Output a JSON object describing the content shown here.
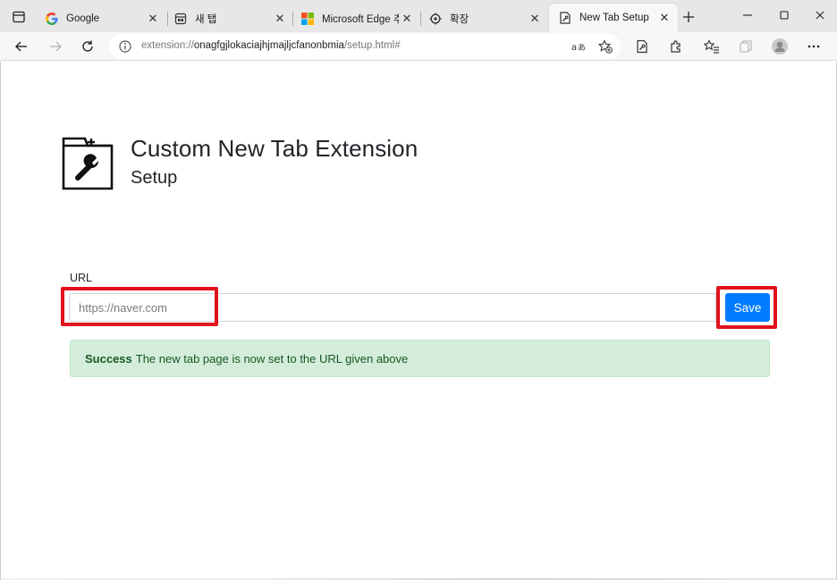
{
  "browser": {
    "tabs": [
      {
        "title": "Google",
        "favicon": "google-g-icon",
        "active": false
      },
      {
        "title": "새 탭",
        "favicon": "new-tab-page-icon",
        "active": false
      },
      {
        "title": "Microsoft Edge 추가",
        "favicon": "microsoft-logo-icon",
        "active": false
      },
      {
        "title": "확장",
        "favicon": "extensions-puzzle-icon",
        "active": false
      },
      {
        "title": "New Tab Setup",
        "favicon": "document-tools-icon",
        "active": true
      }
    ],
    "address": {
      "scheme": "extension://",
      "host": "onagfgjlokaciajhjmajljcfanonbmia",
      "path": "/setup.html#"
    }
  },
  "page": {
    "title": "Custom New Tab Extension",
    "subtitle": "Setup",
    "url_label": "URL",
    "url_placeholder": "https://naver.com",
    "url_value": "",
    "save_label": "Save",
    "alert": {
      "strong": "Success",
      "message": "The new tab page is now set to the URL given above"
    }
  },
  "colors": {
    "accent_button": "#007bff",
    "success_bg": "#d4edda",
    "success_text": "#155724",
    "highlight_box": "#e0121d"
  }
}
